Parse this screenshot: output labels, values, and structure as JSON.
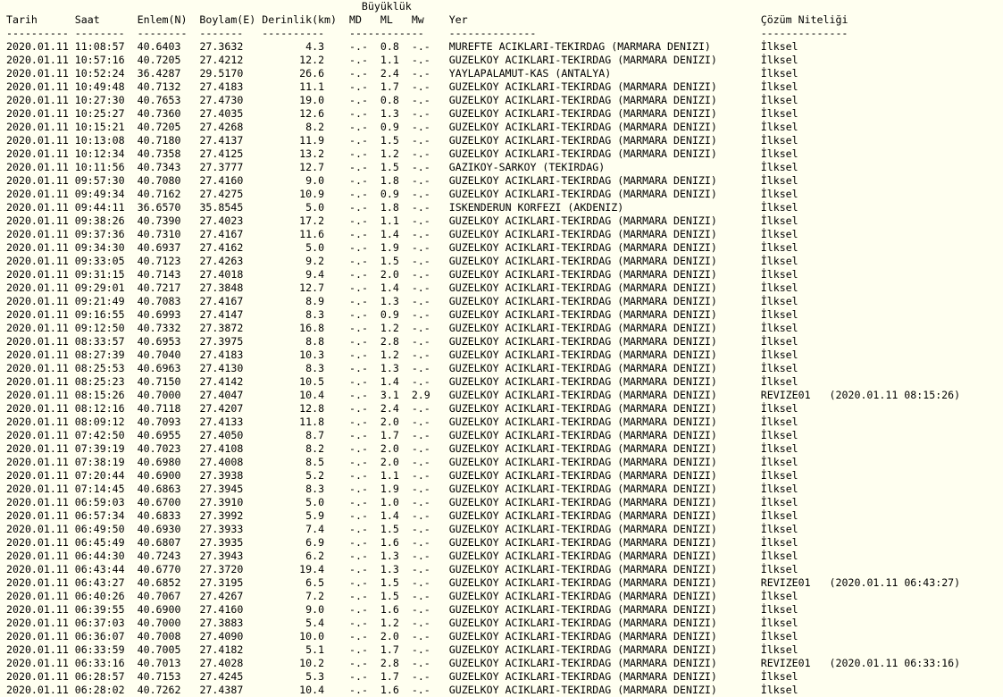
{
  "header": {
    "group_label": "Büyüklük",
    "col_tarih": "Tarih",
    "col_saat": "Saat",
    "col_enlem": "Enlem(N)",
    "col_boylam": "Boylam(E)",
    "col_derinlik": "Derinlik(km)",
    "col_md": "MD",
    "col_ml": "ML",
    "col_mw": "Mw",
    "col_yer": "Yer",
    "col_cozum": "Çözüm Niteliği",
    "sep_tarih": "----------",
    "sep_saat": "--------",
    "sep_enlem": "--------",
    "sep_boylam": "-------",
    "sep_derinlik": "----------",
    "sep_mag": "------------",
    "sep_yer": "--------------",
    "sep_cozum": "--------------"
  },
  "rows": [
    [
      "2020.01.11",
      "11:08:57",
      "40.6403",
      "27.3632",
      "4.3",
      "-.-",
      "0.8",
      "-.-",
      "MUREFTE ACIKLARI-TEKIRDAG (MARMARA DENIZI)",
      "İlksel"
    ],
    [
      "2020.01.11",
      "10:57:16",
      "40.7205",
      "27.4212",
      "12.2",
      "-.-",
      "1.1",
      "-.-",
      "GUZELKOY ACIKLARI-TEKIRDAG (MARMARA DENIZI)",
      "İlksel"
    ],
    [
      "2020.01.11",
      "10:52:24",
      "36.4287",
      "29.5170",
      "26.6",
      "-.-",
      "2.4",
      "-.-",
      "YAYLAPALAMUT-KAS (ANTALYA)",
      "İlksel"
    ],
    [
      "2020.01.11",
      "10:49:48",
      "40.7132",
      "27.4183",
      "11.1",
      "-.-",
      "1.7",
      "-.-",
      "GUZELKOY ACIKLARI-TEKIRDAG (MARMARA DENIZI)",
      "İlksel"
    ],
    [
      "2020.01.11",
      "10:27:30",
      "40.7653",
      "27.4730",
      "19.0",
      "-.-",
      "0.8",
      "-.-",
      "GUZELKOY ACIKLARI-TEKIRDAG (MARMARA DENIZI)",
      "İlksel"
    ],
    [
      "2020.01.11",
      "10:25:27",
      "40.7360",
      "27.4035",
      "12.6",
      "-.-",
      "1.3",
      "-.-",
      "GUZELKOY ACIKLARI-TEKIRDAG (MARMARA DENIZI)",
      "İlksel"
    ],
    [
      "2020.01.11",
      "10:15:21",
      "40.7205",
      "27.4268",
      "8.2",
      "-.-",
      "0.9",
      "-.-",
      "GUZELKOY ACIKLARI-TEKIRDAG (MARMARA DENIZI)",
      "İlksel"
    ],
    [
      "2020.01.11",
      "10:13:08",
      "40.7180",
      "27.4137",
      "11.9",
      "-.-",
      "1.5",
      "-.-",
      "GUZELKOY ACIKLARI-TEKIRDAG (MARMARA DENIZI)",
      "İlksel"
    ],
    [
      "2020.01.11",
      "10:12:34",
      "40.7358",
      "27.4125",
      "13.2",
      "-.-",
      "1.2",
      "-.-",
      "GUZELKOY ACIKLARI-TEKIRDAG (MARMARA DENIZI)",
      "İlksel"
    ],
    [
      "2020.01.11",
      "10:11:56",
      "40.7343",
      "27.3777",
      "12.7",
      "-.-",
      "1.5",
      "-.-",
      "GAZIKOY-SARKOY (TEKIRDAG)",
      "İlksel"
    ],
    [
      "2020.01.11",
      "09:57:30",
      "40.7080",
      "27.4160",
      "9.0",
      "-.-",
      "1.8",
      "-.-",
      "GUZELKOY ACIKLARI-TEKIRDAG (MARMARA DENIZI)",
      "İlksel"
    ],
    [
      "2020.01.11",
      "09:49:34",
      "40.7162",
      "27.4275",
      "10.9",
      "-.-",
      "0.9",
      "-.-",
      "GUZELKOY ACIKLARI-TEKIRDAG (MARMARA DENIZI)",
      "İlksel"
    ],
    [
      "2020.01.11",
      "09:44:11",
      "36.6570",
      "35.8545",
      "5.0",
      "-.-",
      "1.8",
      "-.-",
      "ISKENDERUN KORFEZI (AKDENIZ)",
      "İlksel"
    ],
    [
      "2020.01.11",
      "09:38:26",
      "40.7390",
      "27.4023",
      "17.2",
      "-.-",
      "1.1",
      "-.-",
      "GUZELKOY ACIKLARI-TEKIRDAG (MARMARA DENIZI)",
      "İlksel"
    ],
    [
      "2020.01.11",
      "09:37:36",
      "40.7310",
      "27.4167",
      "11.6",
      "-.-",
      "1.4",
      "-.-",
      "GUZELKOY ACIKLARI-TEKIRDAG (MARMARA DENIZI)",
      "İlksel"
    ],
    [
      "2020.01.11",
      "09:34:30",
      "40.6937",
      "27.4162",
      "5.0",
      "-.-",
      "1.9",
      "-.-",
      "GUZELKOY ACIKLARI-TEKIRDAG (MARMARA DENIZI)",
      "İlksel"
    ],
    [
      "2020.01.11",
      "09:33:05",
      "40.7123",
      "27.4263",
      "9.2",
      "-.-",
      "1.5",
      "-.-",
      "GUZELKOY ACIKLARI-TEKIRDAG (MARMARA DENIZI)",
      "İlksel"
    ],
    [
      "2020.01.11",
      "09:31:15",
      "40.7143",
      "27.4018",
      "9.4",
      "-.-",
      "2.0",
      "-.-",
      "GUZELKOY ACIKLARI-TEKIRDAG (MARMARA DENIZI)",
      "İlksel"
    ],
    [
      "2020.01.11",
      "09:29:01",
      "40.7217",
      "27.3848",
      "12.7",
      "-.-",
      "1.4",
      "-.-",
      "GUZELKOY ACIKLARI-TEKIRDAG (MARMARA DENIZI)",
      "İlksel"
    ],
    [
      "2020.01.11",
      "09:21:49",
      "40.7083",
      "27.4167",
      "8.9",
      "-.-",
      "1.3",
      "-.-",
      "GUZELKOY ACIKLARI-TEKIRDAG (MARMARA DENIZI)",
      "İlksel"
    ],
    [
      "2020.01.11",
      "09:16:55",
      "40.6993",
      "27.4147",
      "8.3",
      "-.-",
      "0.9",
      "-.-",
      "GUZELKOY ACIKLARI-TEKIRDAG (MARMARA DENIZI)",
      "İlksel"
    ],
    [
      "2020.01.11",
      "09:12:50",
      "40.7332",
      "27.3872",
      "16.8",
      "-.-",
      "1.2",
      "-.-",
      "GUZELKOY ACIKLARI-TEKIRDAG (MARMARA DENIZI)",
      "İlksel"
    ],
    [
      "2020.01.11",
      "08:33:57",
      "40.6953",
      "27.3975",
      "8.8",
      "-.-",
      "2.8",
      "-.-",
      "GUZELKOY ACIKLARI-TEKIRDAG (MARMARA DENIZI)",
      "İlksel"
    ],
    [
      "2020.01.11",
      "08:27:39",
      "40.7040",
      "27.4183",
      "10.3",
      "-.-",
      "1.2",
      "-.-",
      "GUZELKOY ACIKLARI-TEKIRDAG (MARMARA DENIZI)",
      "İlksel"
    ],
    [
      "2020.01.11",
      "08:25:53",
      "40.6963",
      "27.4130",
      "8.3",
      "-.-",
      "1.3",
      "-.-",
      "GUZELKOY ACIKLARI-TEKIRDAG (MARMARA DENIZI)",
      "İlksel"
    ],
    [
      "2020.01.11",
      "08:25:23",
      "40.7150",
      "27.4142",
      "10.5",
      "-.-",
      "1.4",
      "-.-",
      "GUZELKOY ACIKLARI-TEKIRDAG (MARMARA DENIZI)",
      "İlksel"
    ],
    [
      "2020.01.11",
      "08:15:26",
      "40.7000",
      "27.4047",
      "10.4",
      "-.-",
      "3.1",
      "2.9",
      "GUZELKOY ACIKLARI-TEKIRDAG (MARMARA DENIZI)",
      "REVIZE01   (2020.01.11 08:15:26)"
    ],
    [
      "2020.01.11",
      "08:12:16",
      "40.7118",
      "27.4207",
      "12.8",
      "-.-",
      "2.4",
      "-.-",
      "GUZELKOY ACIKLARI-TEKIRDAG (MARMARA DENIZI)",
      "İlksel"
    ],
    [
      "2020.01.11",
      "08:09:12",
      "40.7093",
      "27.4133",
      "11.8",
      "-.-",
      "2.0",
      "-.-",
      "GUZELKOY ACIKLARI-TEKIRDAG (MARMARA DENIZI)",
      "İlksel"
    ],
    [
      "2020.01.11",
      "07:42:50",
      "40.6955",
      "27.4050",
      "8.7",
      "-.-",
      "1.7",
      "-.-",
      "GUZELKOY ACIKLARI-TEKIRDAG (MARMARA DENIZI)",
      "İlksel"
    ],
    [
      "2020.01.11",
      "07:39:19",
      "40.7023",
      "27.4108",
      "8.2",
      "-.-",
      "2.0",
      "-.-",
      "GUZELKOY ACIKLARI-TEKIRDAG (MARMARA DENIZI)",
      "İlksel"
    ],
    [
      "2020.01.11",
      "07:38:19",
      "40.6980",
      "27.4008",
      "8.5",
      "-.-",
      "2.0",
      "-.-",
      "GUZELKOY ACIKLARI-TEKIRDAG (MARMARA DENIZI)",
      "İlksel"
    ],
    [
      "2020.01.11",
      "07:20:44",
      "40.6900",
      "27.3938",
      "5.2",
      "-.-",
      "1.1",
      "-.-",
      "GUZELKOY ACIKLARI-TEKIRDAG (MARMARA DENIZI)",
      "İlksel"
    ],
    [
      "2020.01.11",
      "07:14:45",
      "40.6863",
      "27.3945",
      "8.3",
      "-.-",
      "1.9",
      "-.-",
      "GUZELKOY ACIKLARI-TEKIRDAG (MARMARA DENIZI)",
      "İlksel"
    ],
    [
      "2020.01.11",
      "06:59:03",
      "40.6700",
      "27.3910",
      "5.0",
      "-.-",
      "1.0",
      "-.-",
      "GUZELKOY ACIKLARI-TEKIRDAG (MARMARA DENIZI)",
      "İlksel"
    ],
    [
      "2020.01.11",
      "06:57:34",
      "40.6833",
      "27.3992",
      "5.9",
      "-.-",
      "1.4",
      "-.-",
      "GUZELKOY ACIKLARI-TEKIRDAG (MARMARA DENIZI)",
      "İlksel"
    ],
    [
      "2020.01.11",
      "06:49:50",
      "40.6930",
      "27.3933",
      "7.4",
      "-.-",
      "1.5",
      "-.-",
      "GUZELKOY ACIKLARI-TEKIRDAG (MARMARA DENIZI)",
      "İlksel"
    ],
    [
      "2020.01.11",
      "06:45:49",
      "40.6807",
      "27.3935",
      "6.9",
      "-.-",
      "1.6",
      "-.-",
      "GUZELKOY ACIKLARI-TEKIRDAG (MARMARA DENIZI)",
      "İlksel"
    ],
    [
      "2020.01.11",
      "06:44:30",
      "40.7243",
      "27.3943",
      "6.2",
      "-.-",
      "1.3",
      "-.-",
      "GUZELKOY ACIKLARI-TEKIRDAG (MARMARA DENIZI)",
      "İlksel"
    ],
    [
      "2020.01.11",
      "06:43:44",
      "40.6770",
      "27.3720",
      "19.4",
      "-.-",
      "1.3",
      "-.-",
      "GUZELKOY ACIKLARI-TEKIRDAG (MARMARA DENIZI)",
      "İlksel"
    ],
    [
      "2020.01.11",
      "06:43:27",
      "40.6852",
      "27.3195",
      "6.5",
      "-.-",
      "1.5",
      "-.-",
      "GUZELKOY ACIKLARI-TEKIRDAG (MARMARA DENIZI)",
      "REVIZE01   (2020.01.11 06:43:27)"
    ],
    [
      "2020.01.11",
      "06:40:26",
      "40.7067",
      "27.4267",
      "7.2",
      "-.-",
      "1.5",
      "-.-",
      "GUZELKOY ACIKLARI-TEKIRDAG (MARMARA DENIZI)",
      "İlksel"
    ],
    [
      "2020.01.11",
      "06:39:55",
      "40.6900",
      "27.4160",
      "9.0",
      "-.-",
      "1.6",
      "-.-",
      "GUZELKOY ACIKLARI-TEKIRDAG (MARMARA DENIZI)",
      "İlksel"
    ],
    [
      "2020.01.11",
      "06:37:03",
      "40.7000",
      "27.3883",
      "5.4",
      "-.-",
      "1.2",
      "-.-",
      "GUZELKOY ACIKLARI-TEKIRDAG (MARMARA DENIZI)",
      "İlksel"
    ],
    [
      "2020.01.11",
      "06:36:07",
      "40.7008",
      "27.4090",
      "10.0",
      "-.-",
      "2.0",
      "-.-",
      "GUZELKOY ACIKLARI-TEKIRDAG (MARMARA DENIZI)",
      "İlksel"
    ],
    [
      "2020.01.11",
      "06:33:59",
      "40.7005",
      "27.4182",
      "5.1",
      "-.-",
      "1.7",
      "-.-",
      "GUZELKOY ACIKLARI-TEKIRDAG (MARMARA DENIZI)",
      "İlksel"
    ],
    [
      "2020.01.11",
      "06:33:16",
      "40.7013",
      "27.4028",
      "10.2",
      "-.-",
      "2.8",
      "-.-",
      "GUZELKOY ACIKLARI-TEKIRDAG (MARMARA DENIZI)",
      "REVIZE01   (2020.01.11 06:33:16)"
    ],
    [
      "2020.01.11",
      "06:28:57",
      "40.7153",
      "27.4245",
      "5.3",
      "-.-",
      "1.7",
      "-.-",
      "GUZELKOY ACIKLARI-TEKIRDAG (MARMARA DENIZI)",
      "İlksel"
    ],
    [
      "2020.01.11",
      "06:28:02",
      "40.7262",
      "27.4387",
      "10.4",
      "-.-",
      "1.6",
      "-.-",
      "GUZELKOY ACIKLARI-TEKIRDAG (MARMARA DENIZI)",
      "İlksel"
    ]
  ]
}
